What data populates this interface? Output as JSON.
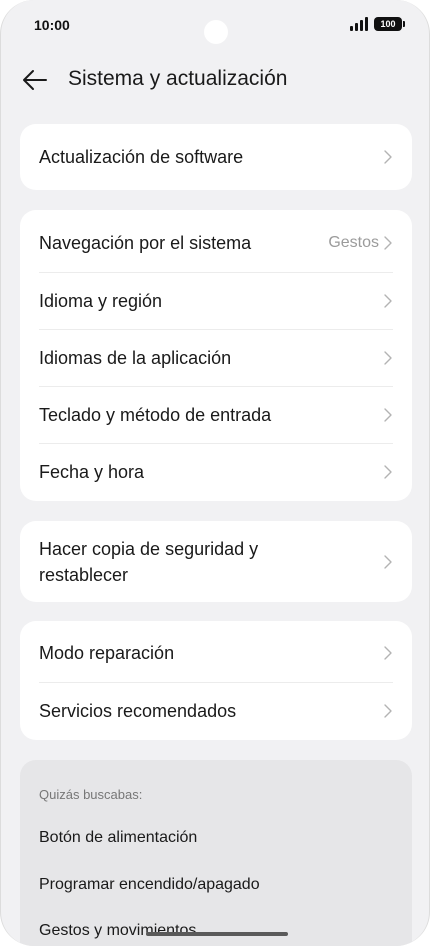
{
  "status_bar": {
    "time": "10:00",
    "battery": "100",
    "icons": [
      "signal-icon",
      "battery-icon"
    ]
  },
  "header": {
    "title": "Sistema y actualización",
    "back_icon": "arrow-left-icon"
  },
  "groups": {
    "software": {
      "items": [
        {
          "label": "Actualización de software"
        }
      ]
    },
    "system": {
      "items": [
        {
          "label": "Navegación por el sistema",
          "value": "Gestos"
        },
        {
          "label": "Idioma y región"
        },
        {
          "label": "Idiomas de la aplicación"
        },
        {
          "label": "Teclado y método de entrada"
        },
        {
          "label": "Fecha y hora"
        }
      ]
    },
    "backup": {
      "items": [
        {
          "label": "Hacer copia de seguridad y restablecer"
        }
      ]
    },
    "repair": {
      "items": [
        {
          "label": "Modo reparación"
        },
        {
          "label": "Servicios recomendados"
        }
      ]
    }
  },
  "suggestions": {
    "heading": "Quizás buscabas:",
    "items": [
      "Botón de alimentación",
      "Programar encendido/apagado",
      "Gestos y movimientos"
    ]
  },
  "colors": {
    "background": "#f1f1f3",
    "card": "#ffffff",
    "suggest_card": "#e6e6e8",
    "secondary_text": "#9b9b9b"
  }
}
